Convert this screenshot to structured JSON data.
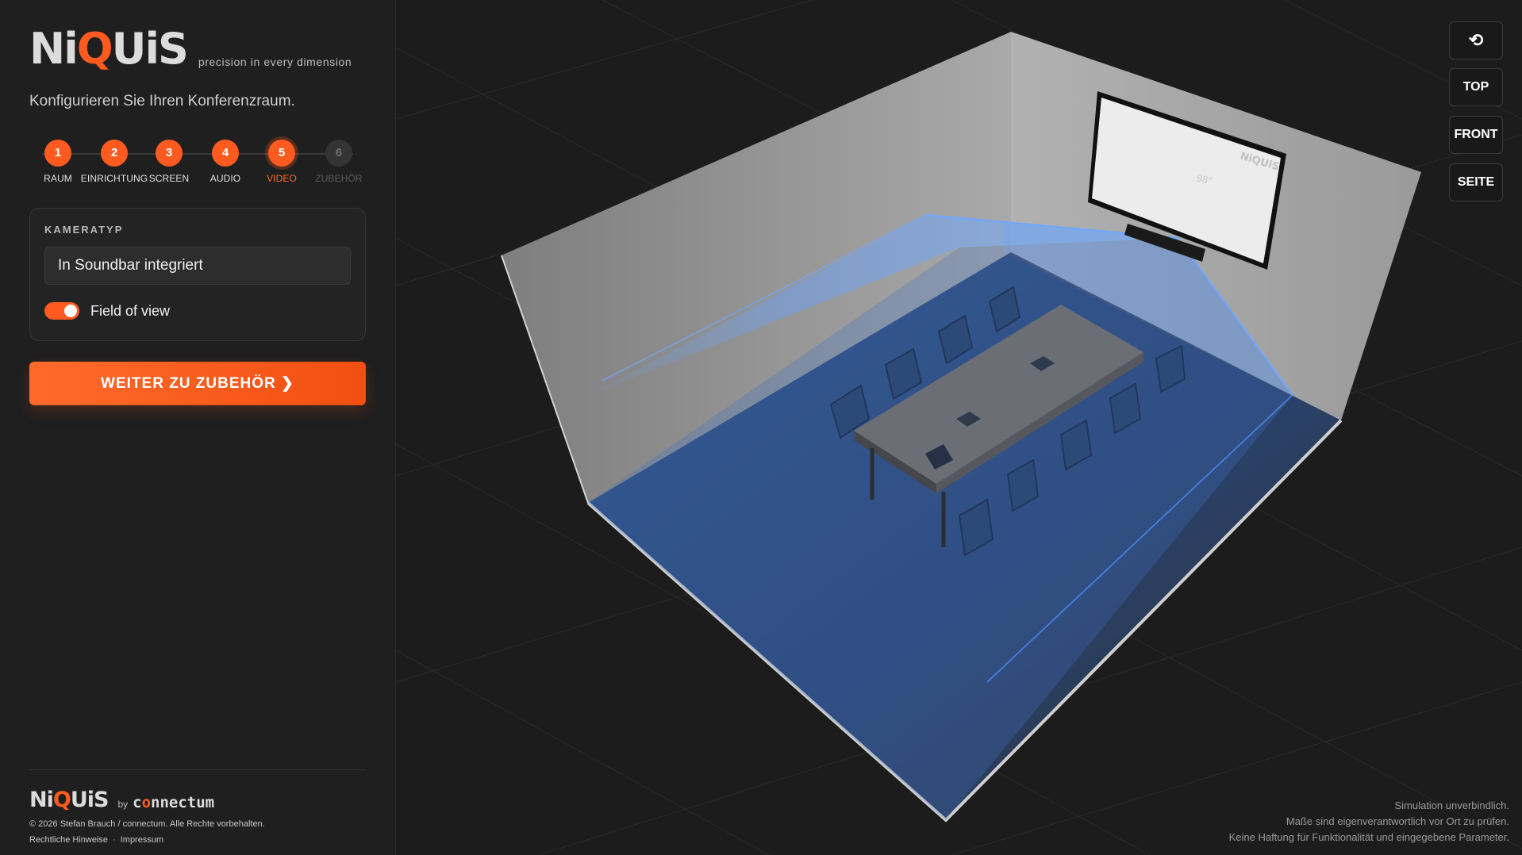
{
  "brand": {
    "logo_pre": "Ni",
    "logo_q": "Q",
    "logo_post": "UiS",
    "tagline": "precision in every dimension",
    "accent_color": "#ff5a1f"
  },
  "subtitle": "Konfigurieren Sie Ihren Konferenzraum.",
  "steps": [
    {
      "num": "1",
      "label": "RAUM",
      "state": "done"
    },
    {
      "num": "2",
      "label": "EINRICHTUNG",
      "state": "done"
    },
    {
      "num": "3",
      "label": "SCREEN",
      "state": "done"
    },
    {
      "num": "4",
      "label": "AUDIO",
      "state": "done"
    },
    {
      "num": "5",
      "label": "VIDEO",
      "state": "active"
    },
    {
      "num": "6",
      "label": "ZUBEHÖR",
      "state": "disabled"
    }
  ],
  "camera_card": {
    "title": "KAMERATYP",
    "selected": "In Soundbar integriert",
    "toggle_label": "Field of view",
    "toggle_on": true
  },
  "cta_label": "WEITER ZU ZUBEHÖR ❯",
  "footer": {
    "by": "by",
    "brand_pre": "c",
    "brand_o": "o",
    "brand_post": "nnectum",
    "copyright": "© 2026 Stefan Brauch / connectum. Alle Rechte vorbehalten.",
    "legal_link": "Rechtliche Hinweise",
    "impressum_link": "Impressum"
  },
  "view_controls": {
    "reset_icon": "reset-rotate-icon",
    "top": "TOP",
    "front": "FRONT",
    "side": "SEITE"
  },
  "scene": {
    "fov_angle_label": "98°",
    "screen_logo": "NiQUiS"
  },
  "disclaimer": {
    "line1": "Simulation unverbindlich.",
    "line2": "Maße sind eigenverantwortlich vor Ort zu prüfen.",
    "line3": "Keine Haftung für Funktionalität und eingegebene Parameter."
  }
}
